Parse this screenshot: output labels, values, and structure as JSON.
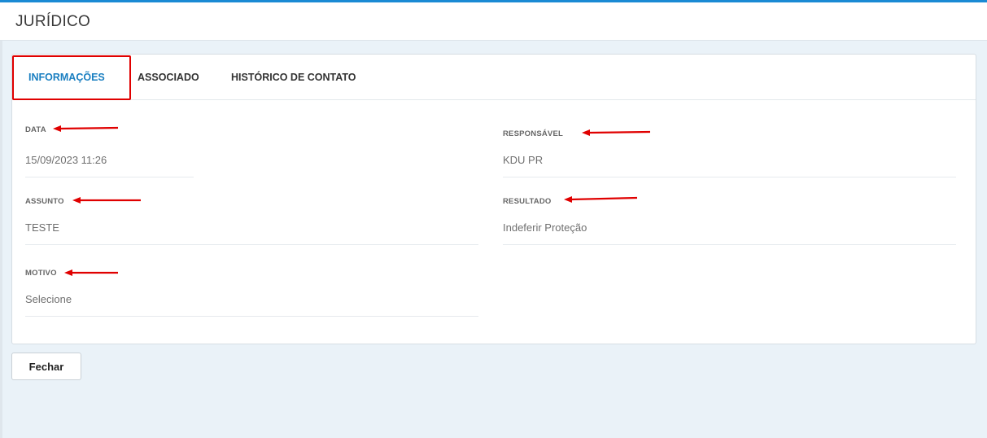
{
  "header": {
    "title": "JURÍDICO"
  },
  "tabs": [
    {
      "label": "INFORMAÇÕES",
      "active": true
    },
    {
      "label": "ASSOCIADO",
      "active": false
    },
    {
      "label": "HISTÓRICO DE CONTATO",
      "active": false
    }
  ],
  "fields": {
    "data": {
      "label": "DATA",
      "value": "15/09/2023 11:26"
    },
    "responsavel": {
      "label": "RESPONSÁVEL",
      "value": "KDU PR"
    },
    "assunto": {
      "label": "ASSUNTO",
      "value": "TESTE"
    },
    "resultado": {
      "label": "RESULTADO",
      "value": "Indeferir Proteção"
    },
    "motivo": {
      "label": "MOTIVO",
      "value": "Selecione"
    }
  },
  "buttons": {
    "close_label": "Fechar"
  },
  "colors": {
    "accent": "#1a8ad4",
    "active_tab": "#1a7fc1",
    "annotation": "#e00000",
    "background": "#eaf2f8"
  }
}
